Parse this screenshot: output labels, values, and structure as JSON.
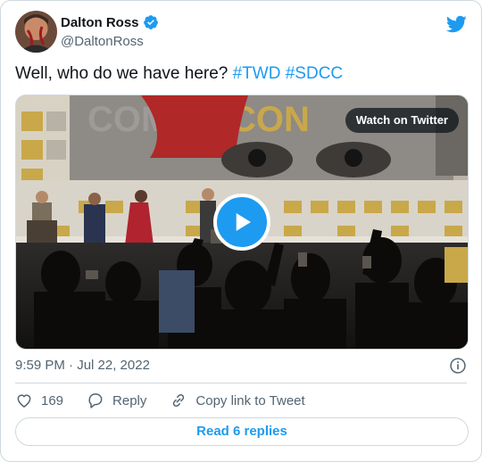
{
  "author": {
    "display_name": "Dalton Ross",
    "handle": "@DaltonRoss",
    "verified": true
  },
  "tweet": {
    "text_prefix": "Well, who do we have here? ",
    "hashtags": [
      "#TWD",
      "#SDCC"
    ]
  },
  "media": {
    "watch_label": "Watch on Twitter",
    "type": "video"
  },
  "timestamp": "9:59 PM · Jul 22, 2022",
  "actions": {
    "likes": "169",
    "reply_label": "Reply",
    "copy_label": "Copy link to Tweet"
  },
  "read_replies_label": "Read 6 replies",
  "colors": {
    "accent": "#1d9bf0",
    "text": "#0f1419",
    "secondary": "#536471",
    "border": "#cfd9de"
  },
  "icons": [
    "verified-badge-icon",
    "twitter-bird-icon",
    "play-icon",
    "info-icon",
    "heart-icon",
    "reply-icon",
    "link-icon"
  ]
}
